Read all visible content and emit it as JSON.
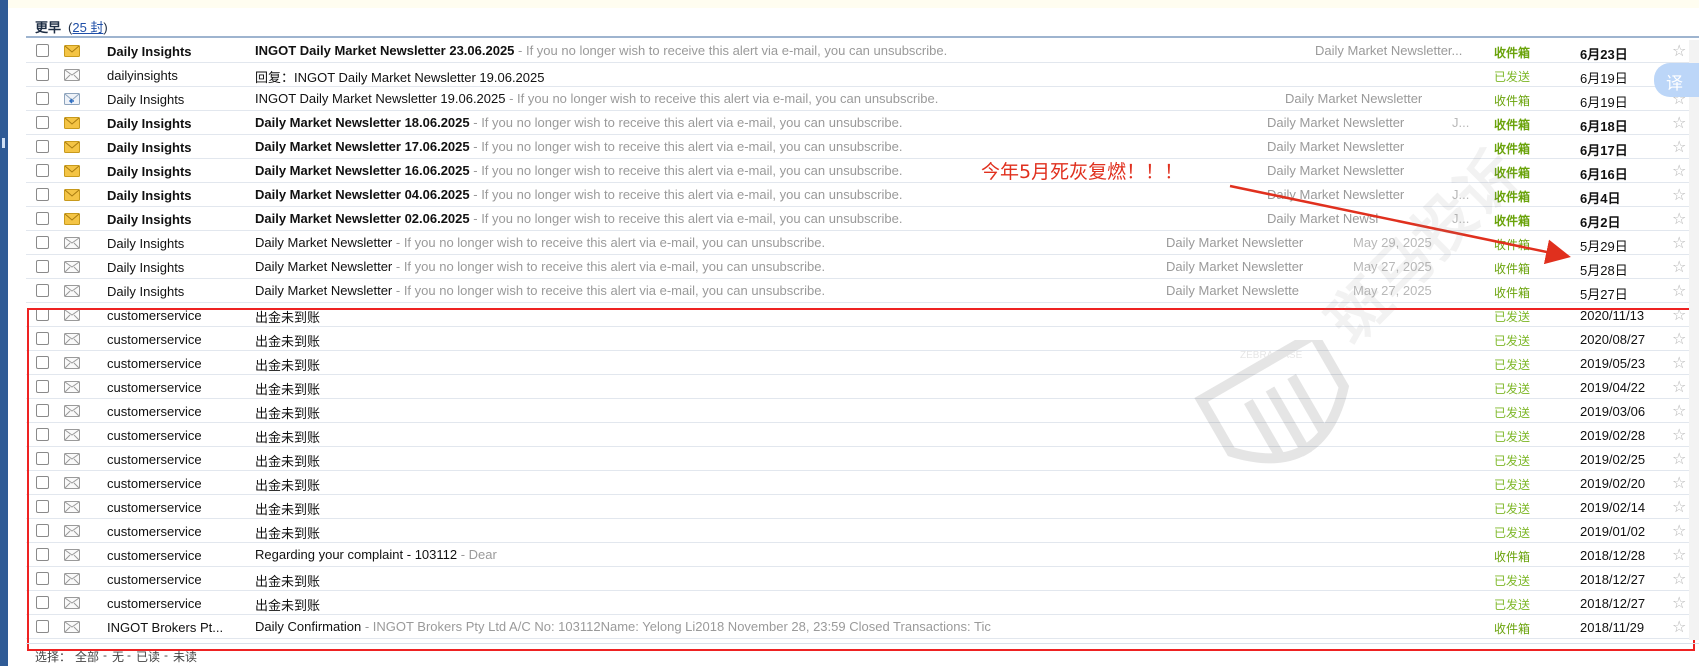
{
  "group": {
    "title": "更早",
    "count_prefix": "(",
    "count_link": "25 封",
    "count_suffix": ")"
  },
  "colors": {
    "accent": "#2f5b96",
    "inbox": "#6aa30b",
    "sent": "#7fb82a",
    "annotation": "#e0301e"
  },
  "rows": [
    {
      "icon": "unread-envelope-icon",
      "from": "Daily Insights",
      "subject": "INGOT Daily Market Newsletter 23.06.2025",
      "snippet": " - If you no longer wish to receive this alert via e-mail, you can unsubscribe.",
      "tag": "Daily Market Newsletter...",
      "tagdate": "",
      "folder": "收件箱",
      "date": "6月23日",
      "unread": true,
      "folder_kind": "inbox"
    },
    {
      "icon": "envelope-icon",
      "from": "dailyinsights",
      "subject": "回复：INGOT Daily Market Newsletter 19.06.2025",
      "snippet": "",
      "tag": "",
      "tagdate": "",
      "folder": "已发送",
      "date": "6月19日",
      "unread": false,
      "folder_kind": "sent"
    },
    {
      "icon": "replied-envelope-icon",
      "from": "Daily Insights",
      "subject": "INGOT Daily Market Newsletter 19.06.2025",
      "snippet": " - If you no longer wish to receive this alert via e-mail, you can unsubscribe.",
      "tag": "Daily Market Newsletter",
      "tagdate": "",
      "folder": "收件箱",
      "date": "6月19日",
      "unread": false,
      "folder_kind": "inbox-n"
    },
    {
      "icon": "unread-envelope-icon",
      "from": "Daily Insights",
      "subject": "Daily Market Newsletter 18.06.2025",
      "snippet": " - If you no longer wish to receive this alert via e-mail, you can unsubscribe.",
      "tag": "Daily Market Newsletter",
      "tagdate": "J...",
      "folder": "收件箱",
      "date": "6月18日",
      "unread": true,
      "folder_kind": "inbox"
    },
    {
      "icon": "unread-envelope-icon",
      "from": "Daily Insights",
      "subject": "Daily Market Newsletter 17.06.2025",
      "snippet": " - If you no longer wish to receive this alert via e-mail, you can unsubscribe.",
      "tag": "Daily Market Newsletter",
      "tagdate": "",
      "folder": "收件箱",
      "date": "6月17日",
      "unread": true,
      "folder_kind": "inbox"
    },
    {
      "icon": "unread-envelope-icon",
      "from": "Daily Insights",
      "subject": "Daily Market Newsletter 16.06.2025",
      "snippet": " - If you no longer wish to receive this alert via e-mail, you can unsubscribe.",
      "tag": "Daily Market Newsletter",
      "tagdate": "",
      "folder": "收件箱",
      "date": "6月16日",
      "unread": true,
      "folder_kind": "inbox"
    },
    {
      "icon": "unread-envelope-icon",
      "from": "Daily Insights",
      "subject": "Daily Market Newsletter 04.06.2025",
      "snippet": " - If you no longer wish to receive this alert via e-mail, you can unsubscribe.",
      "tag": "Daily Market Newsletter",
      "tagdate": "J...",
      "folder": "收件箱",
      "date": "6月4日",
      "unread": true,
      "folder_kind": "inbox"
    },
    {
      "icon": "unread-envelope-icon",
      "from": "Daily Insights",
      "subject": "Daily Market Newsletter 02.06.2025",
      "snippet": " - If you no longer wish to receive this alert via e-mail, you can unsubscribe.",
      "tag": "Daily Market Newsl",
      "tagdate": "J...",
      "folder": "收件箱",
      "date": "6月2日",
      "unread": true,
      "folder_kind": "inbox"
    },
    {
      "icon": "envelope-icon",
      "from": "Daily Insights",
      "subject": "Daily Market Newsletter",
      "snippet": " - If you no longer wish to receive this alert via e-mail, you can unsubscribe.",
      "tag": "Daily Market Newsletter",
      "tagdate": "May 29, 2025",
      "folder": "收件箱",
      "date": "5月29日",
      "unread": false,
      "folder_kind": "inbox-n"
    },
    {
      "icon": "envelope-icon",
      "from": "Daily Insights",
      "subject": "Daily Market Newsletter",
      "snippet": " - If you no longer wish to receive this alert via e-mail, you can unsubscribe.",
      "tag": "Daily Market Newsletter",
      "tagdate": "May 27, 2025",
      "folder": "收件箱",
      "date": "5月28日",
      "unread": false,
      "folder_kind": "inbox-n"
    },
    {
      "icon": "envelope-icon",
      "from": "Daily Insights",
      "subject": "Daily Market Newsletter",
      "snippet": " - If you no longer wish to receive this alert via e-mail, you can unsubscribe.",
      "tag": "Daily Market Newslette",
      "tagdate": "May 27, 2025",
      "folder": "收件箱",
      "date": "5月27日",
      "unread": false,
      "folder_kind": "inbox-n"
    },
    {
      "icon": "envelope-icon",
      "from": "customerservice",
      "subject": "出金未到账",
      "snippet": "",
      "tag": "",
      "tagdate": "",
      "folder": "已发送",
      "date": "2020/11/13",
      "unread": false,
      "folder_kind": "sent"
    },
    {
      "icon": "envelope-icon",
      "from": "customerservice",
      "subject": "出金未到账",
      "snippet": "",
      "tag": "",
      "tagdate": "",
      "folder": "已发送",
      "date": "2020/08/27",
      "unread": false,
      "folder_kind": "sent"
    },
    {
      "icon": "envelope-icon",
      "from": "customerservice",
      "subject": "出金未到账",
      "snippet": "",
      "tag": "",
      "tagdate": "",
      "folder": "已发送",
      "date": "2019/05/23",
      "unread": false,
      "folder_kind": "sent"
    },
    {
      "icon": "envelope-icon",
      "from": "customerservice",
      "subject": "出金未到账",
      "snippet": "",
      "tag": "",
      "tagdate": "",
      "folder": "已发送",
      "date": "2019/04/22",
      "unread": false,
      "folder_kind": "sent"
    },
    {
      "icon": "envelope-icon",
      "from": "customerservice",
      "subject": "出金未到账",
      "snippet": "",
      "tag": "",
      "tagdate": "",
      "folder": "已发送",
      "date": "2019/03/06",
      "unread": false,
      "folder_kind": "sent"
    },
    {
      "icon": "envelope-icon",
      "from": "customerservice",
      "subject": "出金未到账",
      "snippet": "",
      "tag": "",
      "tagdate": "",
      "folder": "已发送",
      "date": "2019/02/28",
      "unread": false,
      "folder_kind": "sent"
    },
    {
      "icon": "envelope-icon",
      "from": "customerservice",
      "subject": "出金未到账",
      "snippet": "",
      "tag": "",
      "tagdate": "",
      "folder": "已发送",
      "date": "2019/02/25",
      "unread": false,
      "folder_kind": "sent"
    },
    {
      "icon": "envelope-icon",
      "from": "customerservice",
      "subject": "出金未到账",
      "snippet": "",
      "tag": "",
      "tagdate": "",
      "folder": "已发送",
      "date": "2019/02/20",
      "unread": false,
      "folder_kind": "sent"
    },
    {
      "icon": "envelope-icon",
      "from": "customerservice",
      "subject": "出金未到账",
      "snippet": "",
      "tag": "",
      "tagdate": "",
      "folder": "已发送",
      "date": "2019/02/14",
      "unread": false,
      "folder_kind": "sent"
    },
    {
      "icon": "envelope-icon",
      "from": "customerservice",
      "subject": "出金未到账",
      "snippet": "",
      "tag": "",
      "tagdate": "",
      "folder": "已发送",
      "date": "2019/01/02",
      "unread": false,
      "folder_kind": "sent"
    },
    {
      "icon": "envelope-icon",
      "from": "customerservice",
      "subject": "Regarding your complaint - 103112",
      "snippet": " -  Dear",
      "tag": "",
      "tagdate": "",
      "folder": "收件箱",
      "date": "2018/12/28",
      "unread": false,
      "folder_kind": "inbox-n"
    },
    {
      "icon": "envelope-icon",
      "from": "customerservice",
      "subject": "出金未到账",
      "snippet": "",
      "tag": "",
      "tagdate": "",
      "folder": "已发送",
      "date": "2018/12/27",
      "unread": false,
      "folder_kind": "sent"
    },
    {
      "icon": "envelope-icon",
      "from": "customerservice",
      "subject": "出金未到账",
      "snippet": "",
      "tag": "",
      "tagdate": "",
      "folder": "已发送",
      "date": "2018/12/27",
      "unread": false,
      "folder_kind": "sent"
    },
    {
      "icon": "envelope-icon",
      "from": "INGOT Brokers Pt...",
      "subject": "Daily Confirmation",
      "snippet": " - INGOT Brokers Pty Ltd A/C No: 103112Name: Yelong Li2018 November 28, 23:59 Closed Transactions: Tic",
      "tag": "",
      "tagdate": "",
      "folder": "收件箱",
      "date": "2018/11/29",
      "unread": false,
      "folder_kind": "inbox-n"
    }
  ],
  "annotation": {
    "text": "今年5月死灰复燃！！！"
  },
  "translate": {
    "label": "译"
  },
  "footer": {
    "select_label": "选择：",
    "all": "全部",
    "none": "无",
    "read": "已读",
    "unread": "未读",
    "sep": "-"
  },
  "watermark": {
    "text": "斑马投诉",
    "brand": "ZEBRA BASE"
  }
}
